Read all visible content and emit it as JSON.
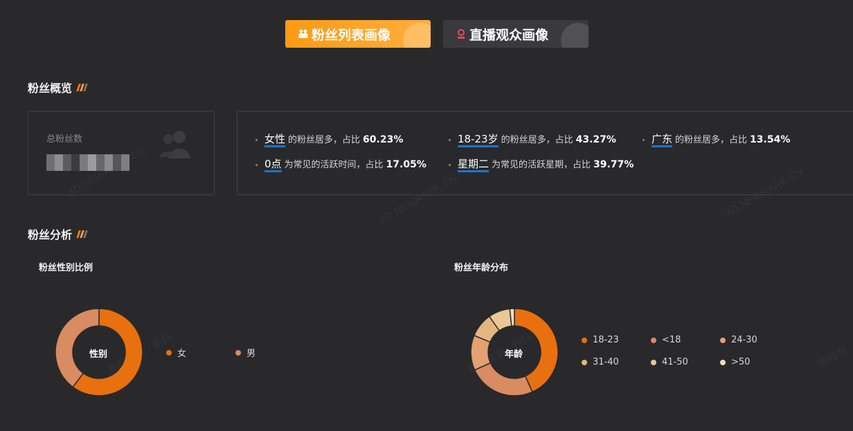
{
  "tabs": [
    {
      "label": "粉丝列表画像",
      "active": true
    },
    {
      "label": "直播观众画像",
      "active": false
    }
  ],
  "watermark": {
    "site": "XD.NEWRANK.CN",
    "brand_cn": "新榜有数 · 新抖",
    "brand_cn_short": "新榜有"
  },
  "overview": {
    "title": "粉丝概览",
    "total_label": "总粉丝数",
    "stats": [
      {
        "key": "女性",
        "text": "的粉丝居多，占比",
        "pct": "60.23%"
      },
      {
        "key": "18-23岁",
        "text": "的粉丝居多，占比",
        "pct": "43.27%"
      },
      {
        "key": "广东",
        "text": "的粉丝居多，占比",
        "pct": "13.54%"
      },
      {
        "key": "0点",
        "text": "为常见的活跃时间，占比",
        "pct": "17.05%"
      },
      {
        "key": "星期二",
        "text": "为常见的活跃星期，占比",
        "pct": "39.77%"
      }
    ]
  },
  "analysis": {
    "title": "粉丝分析"
  },
  "chart_data": [
    {
      "type": "pie",
      "title": "粉丝性别比例",
      "center_label": "性别",
      "categories": [
        "女",
        "男"
      ],
      "values": [
        60.23,
        39.77
      ],
      "colors": [
        "#e8700e",
        "#d98b61"
      ]
    },
    {
      "type": "pie",
      "title": "粉丝年龄分布",
      "center_label": "年龄",
      "categories": [
        "18-23",
        "<18",
        "24-30",
        "31-40",
        "41-50",
        ">50"
      ],
      "values": [
        43.27,
        25.0,
        13.0,
        9.0,
        8.0,
        1.73
      ],
      "colors": [
        "#e8700e",
        "#d98b61",
        "#e3a070",
        "#e3b680",
        "#e8c896",
        "#f2dcb8"
      ]
    }
  ]
}
